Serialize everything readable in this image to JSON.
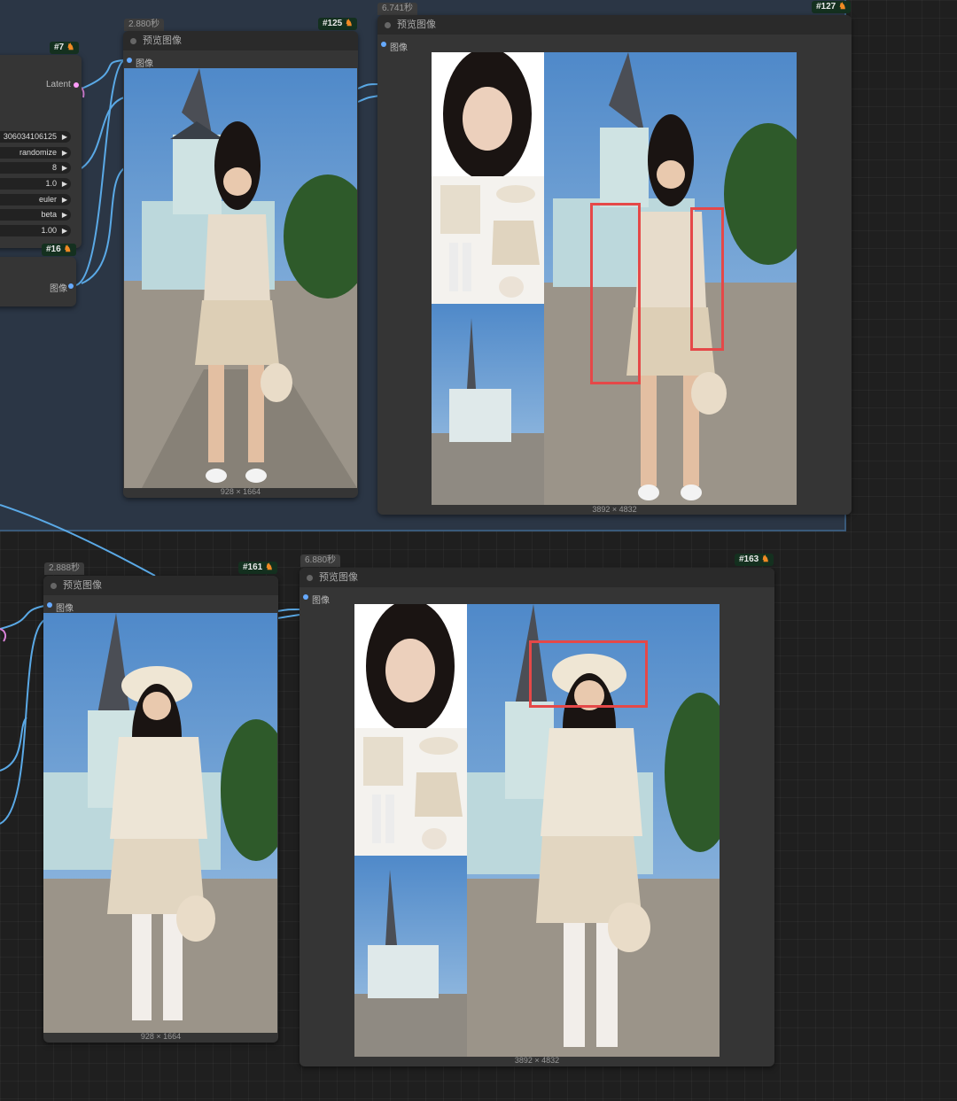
{
  "nodes": {
    "n7": {
      "id": "#7",
      "output_label": "Latent"
    },
    "widgets": [
      {
        "value": "306034106125"
      },
      {
        "value": "randomize"
      },
      {
        "value": "8"
      },
      {
        "value": "1.0"
      },
      {
        "value": "euler"
      },
      {
        "value": "beta"
      },
      {
        "value": "1.00"
      }
    ],
    "n16": {
      "id": "#16",
      "output_label": "图像"
    },
    "n125": {
      "id": "#125",
      "timing": "2.880秒",
      "title": "预览图像",
      "slot_label": "图像",
      "image_size": "928 × 1664"
    },
    "n127": {
      "id": "#127",
      "timing": "6.741秒",
      "title": "预览图像",
      "slot_label": "图像",
      "image_size": "3892 × 4832"
    },
    "n161": {
      "id": "#161",
      "timing": "2.888秒",
      "title": "预览图像",
      "slot_label": "图像",
      "image_size": "928 × 1664"
    },
    "n163": {
      "id": "#163",
      "timing": "6.880秒",
      "title": "预览图像",
      "slot_label": "图像",
      "image_size": "3892 × 4832"
    }
  },
  "colors": {
    "wire": "#5aa9e6",
    "highlight": "#e54848",
    "node_id_bg": "#14301f",
    "canvas": "#1f1f1f"
  },
  "icons": [
    "fox-icon",
    "arrow-right-icon",
    "watermark-icon"
  ]
}
